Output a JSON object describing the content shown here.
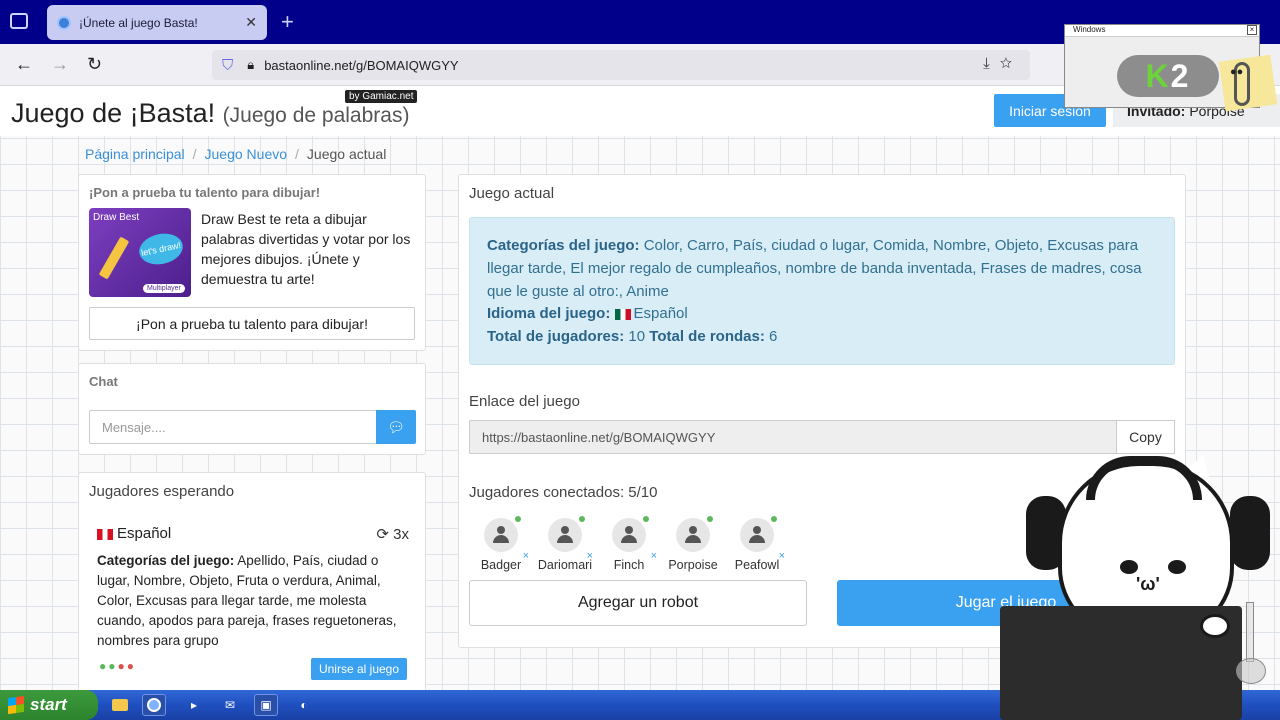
{
  "browser": {
    "tab_title": "¡Únete al juego Basta!",
    "tab_close": "✕",
    "new_tab": "+",
    "url": "bastaonline.net/g/BOMAIQWGYY"
  },
  "header": {
    "brand_main": "Juego de ¡Basta!",
    "brand_sub": "(Juego de palabras)",
    "badge": "by Gamiac.net",
    "login_label": "Iniciar sesión",
    "guest_label": "Invitado:",
    "guest_name": "Porpoise"
  },
  "breadcrumb": {
    "home": "Página principal",
    "new_game": "Juego Nuevo",
    "current": "Juego actual",
    "separator": "/"
  },
  "promo": {
    "heading": "¡Pon a prueba tu talento para dibujar!",
    "image_title": "Draw Best",
    "image_bubble": "let's draw!",
    "image_badge": "Multiplayer",
    "text": "Draw Best te reta a dibujar palabras divertidas y votar por los mejores dibujos. ¡Únete y demuestra tu arte!",
    "button": "¡Pon a prueba tu talento para dibujar!"
  },
  "chat": {
    "heading": "Chat",
    "placeholder": "Mensaje....",
    "send_icon": "message-icon"
  },
  "waiting": {
    "title": "Jugadores esperando",
    "language": "Español",
    "rounds": "3x",
    "categories_label": "Categorías del juego:",
    "categories": "Apellido, País, ciudad o lugar, Nombre, Objeto, Fruta o verdura, Animal, Color, Excusas para llegar tarde, me molesta cuando, apodos para pareja, frases reguetoneras, nombres para grupo",
    "join_button": "Unirse al juego",
    "player_colors": [
      "#5cb85c",
      "#5cb85c",
      "#d9534f",
      "#d9534f"
    ]
  },
  "game": {
    "title": "Juego actual",
    "categories_label": "Categorías del juego:",
    "categories": "Color, Carro, País, ciudad o lugar, Comida, Nombre, Objeto, Excusas para llegar tarde, El mejor regalo de cumpleaños, nombre de banda inventada, Frases de madres, cosa que le guste al otro:, Anime",
    "language_label": "Idioma del juego:",
    "language": "Español",
    "players_label": "Total de jugadores:",
    "players_total": "10",
    "rounds_label": "Total de rondas:",
    "rounds_total": "6",
    "link_label": "Enlace del juego",
    "link": "https://bastaonline.net/g/BOMAIQWGYY",
    "copy_button": "Copy",
    "connected_label": "Jugadores conectados: 5/10",
    "players": [
      {
        "name": "Badger"
      },
      {
        "name": "Dariomari"
      },
      {
        "name": "Finch"
      },
      {
        "name": "Porpoise"
      },
      {
        "name": "Peafowl"
      }
    ],
    "kick_symbol": "×",
    "add_robot_button": "Agregar un robot",
    "play_button": "Jugar el juego"
  },
  "taskbar": {
    "start_label": "start"
  },
  "overlay": {
    "k2_window_title": "Windows",
    "k2_logo_k": "K",
    "k2_logo_2": "2",
    "cat_mouth": "'ω'"
  },
  "colors": {
    "accent": "#3aa0f0",
    "info_bg": "#d9edf7",
    "info_text": "#31708f",
    "online": "#5cb85c",
    "taskbar": "#1f4fbf",
    "tabbar": "#00008b"
  }
}
